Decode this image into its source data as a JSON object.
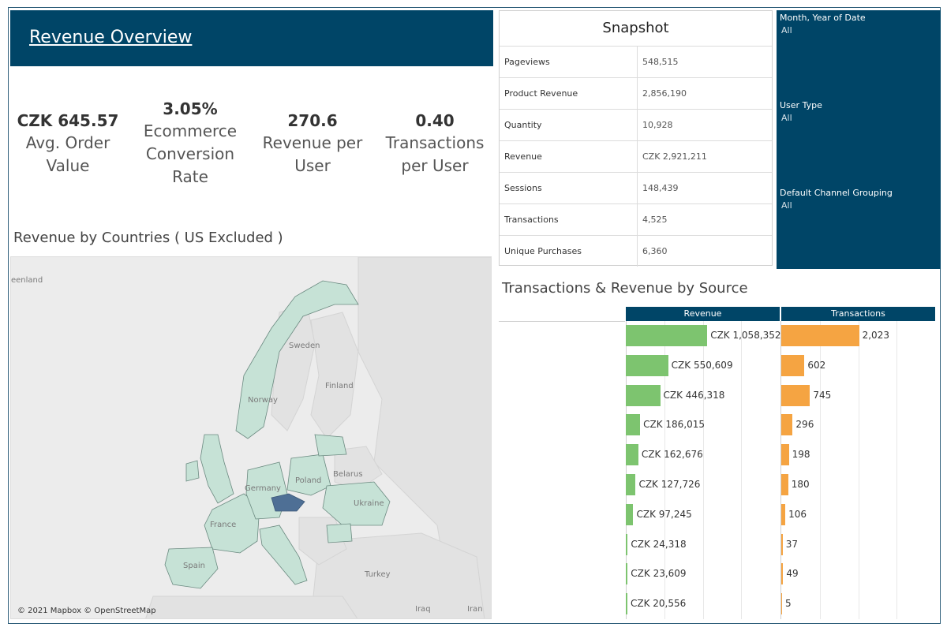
{
  "header": {
    "title": "Revenue Overview"
  },
  "kpis": [
    {
      "value": "CZK 645.57",
      "label": "Avg. Order Value"
    },
    {
      "value": "3.05%",
      "label": "Ecommerce Conversion Rate"
    },
    {
      "value": "270.6",
      "label": "Revenue per User"
    },
    {
      "value": "0.40",
      "label": "Transactions per User"
    }
  ],
  "map": {
    "title": "Revenue by Countries ( US Excluded )",
    "credit": "© 2021 Mapbox © OpenStreetMap",
    "labels": {
      "greenland": "eenland",
      "sweden": "Sweden",
      "finland": "Finland",
      "norway": "Norway",
      "belarus": "Belarus",
      "poland": "Poland",
      "germany": "Germany",
      "ukraine": "Ukraine",
      "france": "France",
      "spain": "Spain",
      "turkey": "Turkey",
      "iraq": "Iraq",
      "iran": "Iran"
    },
    "colors": {
      "land": "#c6e2d6",
      "highlight": "#4e6f95",
      "water": "#ececec"
    }
  },
  "snapshot": {
    "title": "Snapshot",
    "rows": [
      {
        "label": "Pageviews",
        "value": "548,515"
      },
      {
        "label": "Product Revenue",
        "value": "2,856,190"
      },
      {
        "label": "Quantity",
        "value": "10,928"
      },
      {
        "label": "Revenue",
        "value": "CZK 2,921,211"
      },
      {
        "label": "Sessions",
        "value": "148,439"
      },
      {
        "label": "Transactions",
        "value": "4,525"
      },
      {
        "label": "Unique Purchases",
        "value": "6,360"
      }
    ]
  },
  "filters": [
    {
      "title": "Month, Year of Date",
      "value": "All"
    },
    {
      "title": "User Type",
      "value": "All"
    },
    {
      "title": "Default Channel Grouping",
      "value": "All"
    }
  ],
  "sources": {
    "title": "Transactions & Revenue by Source",
    "revenue_header": "Revenue",
    "transactions_header": "Transactions",
    "revenue_color": "#7dc46f",
    "transactions_color": "#f5a442"
  },
  "chart_data": {
    "type": "bar",
    "title": "Transactions & Revenue by Source",
    "series": [
      {
        "name": "Revenue",
        "values": [
          1058352,
          550609,
          446318,
          186015,
          162676,
          127726,
          97245,
          24318,
          23609,
          20556
        ],
        "labels": [
          "CZK 1,058,352",
          "CZK 550,609",
          "CZK 446,318",
          "CZK 186,015",
          "CZK 162,676",
          "CZK 127,726",
          "CZK 97,245",
          "CZK 24,318",
          "CZK 23,609",
          "CZK 20,556"
        ]
      },
      {
        "name": "Transactions",
        "values": [
          2023,
          602,
          745,
          296,
          198,
          180,
          106,
          37,
          49,
          5
        ],
        "labels": [
          "2,023",
          "602",
          "745",
          "296",
          "198",
          "180",
          "106",
          "37",
          "49",
          "5"
        ]
      }
    ],
    "xlim_revenue": [
      0,
      2000000
    ],
    "xlim_transactions": [
      0,
      4000
    ],
    "grid": true,
    "legend": "none"
  }
}
